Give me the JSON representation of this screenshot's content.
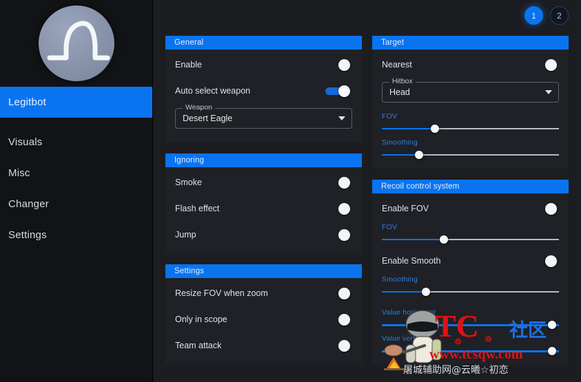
{
  "sidebar": {
    "logo_name": "shark-fin-logo",
    "items": [
      {
        "label": "Legitbot",
        "active": true
      },
      {
        "label": "Visuals",
        "active": false
      },
      {
        "label": "Misc",
        "active": false
      },
      {
        "label": "Changer",
        "active": false
      },
      {
        "label": "Settings",
        "active": false
      }
    ]
  },
  "pager": {
    "pages": [
      {
        "label": "1",
        "active": true
      },
      {
        "label": "2",
        "active": false
      }
    ]
  },
  "panels": {
    "general": {
      "title": "General",
      "rows": [
        {
          "label": "Enable",
          "type": "radio",
          "value": "off"
        },
        {
          "label": "Auto select weapon",
          "type": "switch",
          "value": "on"
        }
      ],
      "select": {
        "label": "Weapon",
        "value": "Desert Eagle",
        "icon": "chevron-down-icon"
      }
    },
    "ignoring": {
      "title": "Ignoring",
      "rows": [
        {
          "label": "Smoke",
          "type": "radio",
          "value": "off"
        },
        {
          "label": "Flash effect",
          "type": "radio",
          "value": "off"
        },
        {
          "label": "Jump",
          "type": "radio",
          "value": "off"
        }
      ]
    },
    "settings": {
      "title": "Settings",
      "rows": [
        {
          "label": "Resize FOV when zoom",
          "type": "radio",
          "value": "off"
        },
        {
          "label": "Only in scope",
          "type": "radio",
          "value": "off"
        },
        {
          "label": "Team attack",
          "type": "radio",
          "value": "off"
        }
      ]
    },
    "target": {
      "title": "Target",
      "rows": [
        {
          "label": "Nearest",
          "type": "radio",
          "value": "off"
        }
      ],
      "select": {
        "label": "Hitbox",
        "value": "Head",
        "icon": "chevron-down-icon"
      },
      "sliders": [
        {
          "label": "FOV",
          "percent": 30
        },
        {
          "label": "Smoothing",
          "percent": 21
        }
      ]
    },
    "recoil": {
      "title": "Recoil control system",
      "enable_fov": {
        "label": "Enable FOV",
        "type": "radio",
        "value": "off"
      },
      "fov_slider": {
        "label": "FOV",
        "percent": 35
      },
      "enable_smooth": {
        "label": "Enable Smooth",
        "type": "radio",
        "value": "off"
      },
      "smoothing_slider": {
        "label": "Smoothing",
        "percent": 25
      },
      "value_sliders": [
        {
          "label": "Value horizontal",
          "percent": 96
        },
        {
          "label": "Value vertical",
          "percent": 96
        }
      ]
    }
  },
  "watermark": {
    "brand": "TC",
    "brand_cn": "社区",
    "url": "www.tcsqw.com",
    "subtitle": "屠城辅助网@云曦☆初恋"
  },
  "colors": {
    "accent": "#0a74f0",
    "panel_bg": "#1f2126",
    "sidebar_bg": "#111316",
    "main_bg": "#1b1d21",
    "slider_label": "#2f7de0",
    "watermark_red": "#e11212",
    "watermark_blue": "#1f6fe0"
  }
}
